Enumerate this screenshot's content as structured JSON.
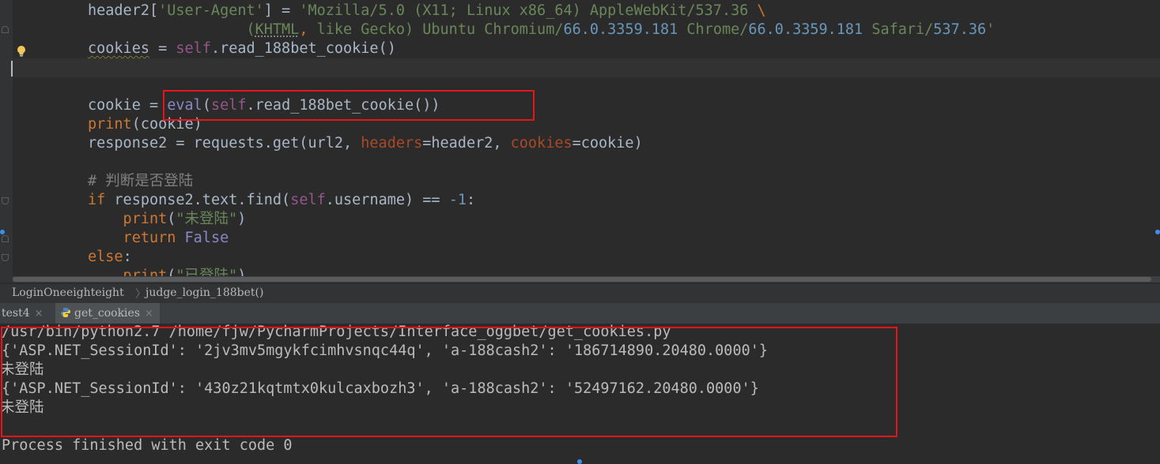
{
  "editor": {
    "lines": [
      {
        "id": "l1",
        "segs": [
          [
            "",
            "header2["
          ],
          [
            "str",
            "'User-Agent'"
          ],
          [
            "",
            "] = "
          ],
          [
            "str",
            "'Mozilla/5.0 (X11; Linux x86_64) AppleWebKit/537.36 "
          ],
          [
            "kw",
            "\\"
          ]
        ]
      },
      {
        "id": "l2",
        "segs": [
          [
            "str",
            "                  ("
          ],
          [
            "str dot",
            "KHTML"
          ],
          [
            "kw",
            ", "
          ],
          [
            "str",
            "like Gecko) Ubuntu Chromium/"
          ],
          [
            "num",
            "66.0.3359.181"
          ],
          [
            "str",
            " Chrome/"
          ],
          [
            "num",
            "66.0.3359.181"
          ],
          [
            "str",
            " Safari/"
          ],
          [
            "num",
            "537.36"
          ],
          [
            "str",
            "'"
          ]
        ]
      },
      {
        "id": "l3",
        "segs": [
          [
            "wavy",
            "cookies"
          ],
          [
            "",
            " = "
          ],
          [
            "slf",
            "self"
          ],
          [
            "",
            ".read_188bet_cookie()"
          ]
        ]
      },
      {
        "id": "l4",
        "segs": [
          [
            "",
            ""
          ]
        ]
      },
      {
        "id": "l5",
        "segs": [
          [
            "",
            ""
          ]
        ]
      },
      {
        "id": "l6",
        "segs": [
          [
            "",
            "cookie = "
          ],
          [
            "bi",
            "eval"
          ],
          [
            "",
            "("
          ],
          [
            "slf",
            "self"
          ],
          [
            "",
            ".read_188bet_cookie())"
          ]
        ]
      },
      {
        "id": "l7",
        "segs": [
          [
            "kw",
            "print"
          ],
          [
            "",
            "(cookie)"
          ]
        ]
      },
      {
        "id": "l8",
        "segs": [
          [
            "",
            "response2 = requests.get(url2, "
          ],
          [
            "prm",
            "headers"
          ],
          [
            "",
            "=header2, "
          ],
          [
            "prm",
            "cookies"
          ],
          [
            "",
            "=cookie)"
          ]
        ]
      },
      {
        "id": "l9",
        "segs": [
          [
            "",
            ""
          ]
        ]
      },
      {
        "id": "l10",
        "segs": [
          [
            "cmt",
            "# 判断是否登陆"
          ]
        ]
      },
      {
        "id": "l11",
        "segs": [
          [
            "kw",
            "if "
          ],
          [
            "",
            "response2.text.find("
          ],
          [
            "slf",
            "self"
          ],
          [
            "",
            ".username) == "
          ],
          [
            "num",
            "-1"
          ],
          [
            "",
            ":"
          ]
        ]
      },
      {
        "id": "l12",
        "segs": [
          [
            "kw",
            "    print"
          ],
          [
            "",
            "("
          ],
          [
            "str",
            "\"未登陆\""
          ],
          [
            "",
            ")"
          ]
        ]
      },
      {
        "id": "l13",
        "segs": [
          [
            "kw",
            "    return "
          ],
          [
            "bi",
            "False"
          ]
        ]
      },
      {
        "id": "l14",
        "segs": [
          [
            "kw",
            "else"
          ],
          [
            "",
            ":"
          ]
        ]
      },
      {
        "id": "l15",
        "segs": [
          [
            "kw",
            "    print"
          ],
          [
            "",
            "("
          ],
          [
            "str",
            "\"已登陆\""
          ],
          [
            "",
            ")"
          ]
        ]
      }
    ]
  },
  "breadcrumb": {
    "class_name": "LoginOneeighteight",
    "method_name": "judge_login_188bet()"
  },
  "run_tabs": [
    {
      "label": "test4",
      "close": "×",
      "active": false
    },
    {
      "label": "get_cookies",
      "close": "×",
      "active": true,
      "icon": "python-icon"
    }
  ],
  "console": {
    "lines": [
      "/usr/bin/python2.7 /home/fjw/PycharmProjects/Interface_oggbet/get_cookies.py",
      "{'ASP.NET_SessionId': '2jv3mv5mgykfcimhvsnqc44q', 'a-188cash2': '186714890.20480.0000'}",
      "未登陆",
      "{'ASP.NET_SessionId': '430z21kqtmtx0kulcaxbozh3', 'a-188cash2': '52497162.20480.0000'}",
      "未登陆",
      "",
      "Process finished with exit code 0"
    ]
  },
  "colors": {
    "background": "#2b2b2b",
    "keyword": "#cc7832",
    "string": "#6a8759",
    "number": "#6897bb",
    "self": "#94558d",
    "param": "#aa4926",
    "annotation_box": "#e8141a"
  }
}
